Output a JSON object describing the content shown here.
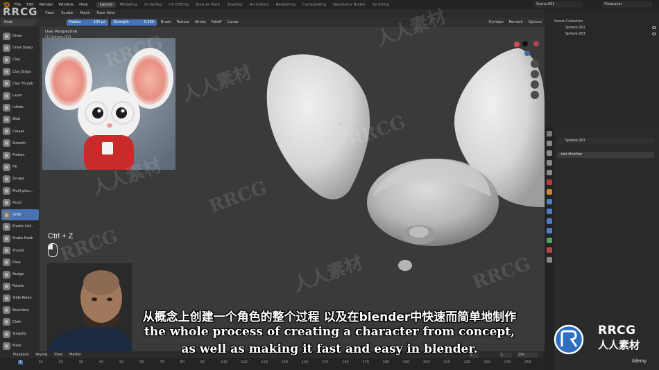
{
  "app": {
    "menu": [
      "File",
      "Edit",
      "Render",
      "Window",
      "Help"
    ],
    "workspace_tabs": [
      "Layout",
      "Modeling",
      "Sculpting",
      "UV Editing",
      "Texture Paint",
      "Shading",
      "Animation",
      "Rendering",
      "Compositing",
      "Geometry Nodes",
      "Scripting"
    ],
    "active_workspace": "Layout",
    "scene": "Scene.001",
    "view_layer": "ViewLayer"
  },
  "view_header": [
    "View",
    "Sculpt",
    "Mask",
    "Face Sets"
  ],
  "tool_settings": {
    "brush": "Grab",
    "radius_label": "Radius",
    "radius_value": "135 px",
    "strength_label": "Strength",
    "strength_value": "0.500",
    "dropdowns": [
      "Brush",
      "Texture",
      "Stroke",
      "Falloff",
      "Cursor"
    ],
    "right_items": [
      "Dyntopo",
      "Remesh",
      "Options"
    ]
  },
  "toolbar": {
    "tools": [
      "Draw",
      "Draw Sharp",
      "Clay",
      "Clay Strips",
      "Clay Thumb",
      "Layer",
      "Inflate",
      "Blob",
      "Crease",
      "Smooth",
      "Flatten",
      "Fill",
      "Scrape",
      "Multi-plan...",
      "Pinch",
      "Grab",
      "Elastic Def...",
      "Snake Hook",
      "Thumb",
      "Pose",
      "Nudge",
      "Rotate",
      "Slide Relax",
      "Boundary",
      "Cloth",
      "Simplify",
      "Mask"
    ],
    "active": "Grab"
  },
  "viewport": {
    "title": "User Perspective",
    "subtitle": "(1) Sphere.003",
    "shortcut": "Ctrl + Z"
  },
  "subtitles": {
    "chinese": "从概念上创建一个角色的整个过程 以及在blender中快速而简单地制作",
    "english_line1": "the whole process of creating a character from concept,",
    "english_line2": "as well as making it fast and easy in blender."
  },
  "timeline": {
    "header": [
      "Playback",
      "Keying",
      "View",
      "Marker"
    ],
    "ticks": [
      "1",
      "10",
      "20",
      "30",
      "40",
      "50",
      "60",
      "70",
      "80",
      "90",
      "100",
      "110",
      "120",
      "130",
      "140",
      "150",
      "160",
      "170",
      "180",
      "190",
      "200",
      "210",
      "220",
      "230",
      "240",
      "250"
    ],
    "current_frame": "1",
    "start": "1",
    "end": "250"
  },
  "outliner": {
    "collection": "Scene Collection",
    "items": [
      "Sphere.002",
      "Sphere.003"
    ]
  },
  "properties": {
    "object_name": "Sphere.003",
    "add_modifier": "Add Modifier"
  },
  "watermarks": {
    "latin": "RRCG",
    "cjk": "人人素材"
  },
  "branding": {
    "corner": "RRCG",
    "badge_name": "RRCG",
    "badge_sub": "人人素材",
    "udemy": "ûdemy"
  },
  "colors": {
    "accent_blue": "#4772b3",
    "viewport_bg": "#3a3a3a",
    "panel_bg": "#2a2a2a"
  }
}
